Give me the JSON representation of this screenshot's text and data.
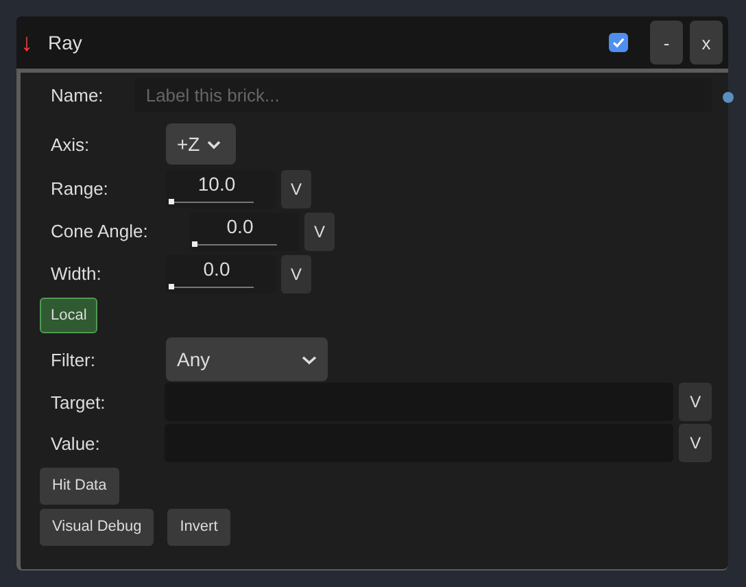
{
  "header": {
    "arrow": "↓",
    "title": "Ray",
    "enabled": true,
    "buttons": [
      "-",
      "x"
    ]
  },
  "name": {
    "label": "Name:",
    "placeholder": "Label this brick..."
  },
  "axis": {
    "label": "Axis:",
    "value": "+Z"
  },
  "numbers": [
    {
      "label": "Range:",
      "value": "10.0",
      "level": 0,
      "button": "V"
    },
    {
      "label": "Cone Angle:",
      "value": "0.0",
      "level": 0,
      "button": "V"
    },
    {
      "label": "Width:",
      "value": "0.0",
      "level": 0,
      "button": "V"
    }
  ],
  "local": {
    "label": "Local",
    "on": true
  },
  "filter": {
    "label": "Filter:",
    "value": "Any"
  },
  "texts": [
    {
      "label": "Target:",
      "button": "V"
    },
    {
      "label": "Value:",
      "button": "V"
    }
  ],
  "toggles": [
    [
      {
        "label": "Hit Data",
        "on": false
      }
    ],
    [
      {
        "label": "Visual Debug",
        "on": false
      },
      {
        "label": "Invert",
        "on": false
      }
    ]
  ]
}
